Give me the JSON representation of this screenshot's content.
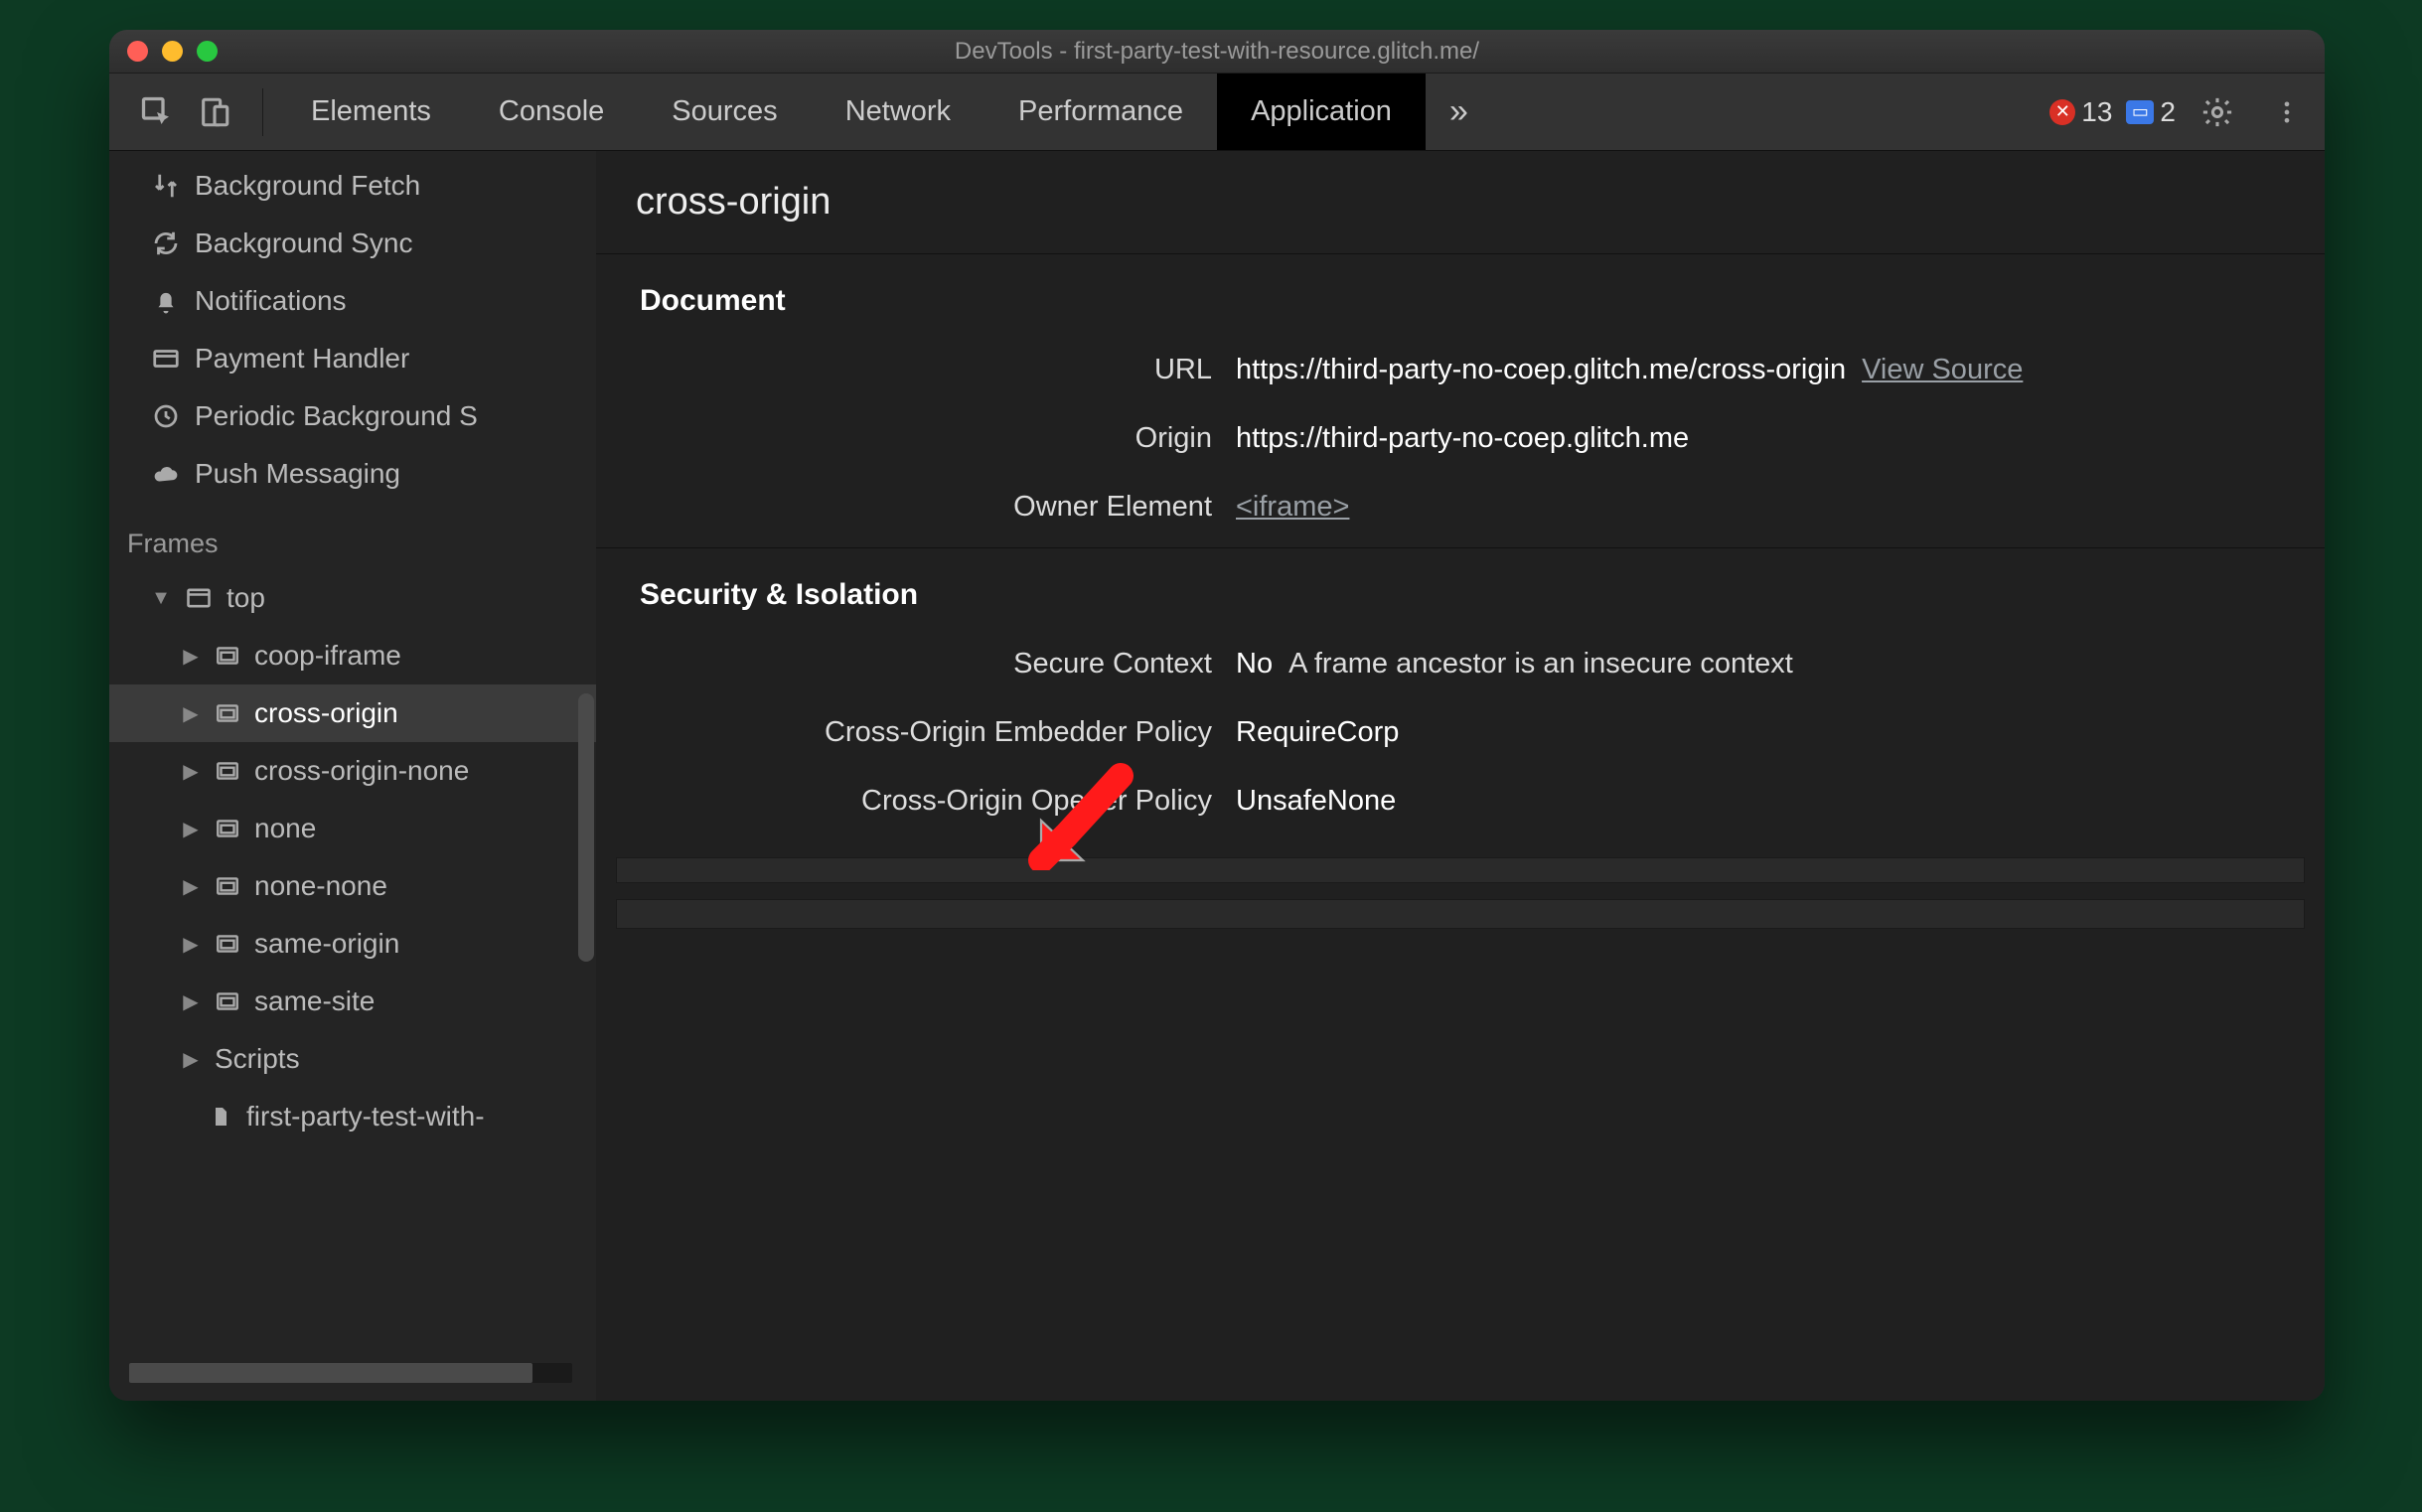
{
  "titlebar": {
    "title": "DevTools - first-party-test-with-resource.glitch.me/"
  },
  "tabs": {
    "items": [
      "Elements",
      "Console",
      "Sources",
      "Network",
      "Performance",
      "Application"
    ],
    "active": "Application",
    "more_glyph": "»",
    "error_count": "13",
    "info_count": "2"
  },
  "sidebar": {
    "background_services": [
      {
        "icon": "fetch",
        "label": "Background Fetch"
      },
      {
        "icon": "sync",
        "label": "Background Sync"
      },
      {
        "icon": "bell",
        "label": "Notifications"
      },
      {
        "icon": "card",
        "label": "Payment Handler"
      },
      {
        "icon": "clock",
        "label": "Periodic Background S"
      },
      {
        "icon": "cloud",
        "label": "Push Messaging"
      }
    ],
    "frames_title": "Frames",
    "frames": {
      "top_label": "top",
      "children": [
        {
          "label": "coop-iframe"
        },
        {
          "label": "cross-origin",
          "selected": true
        },
        {
          "label": "cross-origin-none"
        },
        {
          "label": "none"
        },
        {
          "label": "none-none"
        },
        {
          "label": "same-origin"
        },
        {
          "label": "same-site"
        }
      ],
      "scripts_label": "Scripts",
      "script_item": "first-party-test-with-"
    }
  },
  "detail": {
    "title": "cross-origin",
    "document": {
      "heading": "Document",
      "url_label": "URL",
      "url_value": "https://third-party-no-coep.glitch.me/cross-origin",
      "view_source": "View Source",
      "origin_label": "Origin",
      "origin_value": "https://third-party-no-coep.glitch.me",
      "owner_label": "Owner Element",
      "owner_value": "<iframe>"
    },
    "security": {
      "heading": "Security & Isolation",
      "secure_label": "Secure Context",
      "secure_value": "No",
      "secure_note": "A frame ancestor is an insecure context",
      "coep_label": "Cross-Origin Embedder Policy",
      "coep_value": "RequireCorp",
      "coop_label": "Cross-Origin Opener Policy",
      "coop_value": "UnsafeNone"
    }
  },
  "annotation": {
    "arrow_color": "#ff1a1a"
  }
}
